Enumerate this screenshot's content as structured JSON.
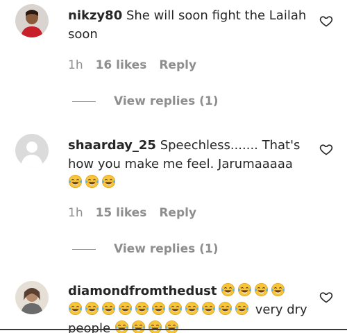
{
  "comments": [
    {
      "username": "nikzy80",
      "text": "She will soon fight the Lailah soon",
      "time": "1h",
      "likes": "16 likes",
      "reply_label": "Reply",
      "view_replies": "View replies (1)"
    },
    {
      "username": "shaarday_25",
      "text": "Speechless....... That's how you make me feel. Jarumaaaaa",
      "time": "1h",
      "likes": "15 likes",
      "reply_label": "Reply",
      "view_replies": "View replies (1)"
    },
    {
      "username": "diamondfromthedust",
      "text_after_emojis": "very dry people"
    }
  ],
  "icons": {
    "like": "heart-icon",
    "emoji": "laughing-tears-emoji"
  },
  "colors": {
    "text": "#262626",
    "secondary": "#8e8e8e",
    "emoji_face": "#f7c53a"
  }
}
